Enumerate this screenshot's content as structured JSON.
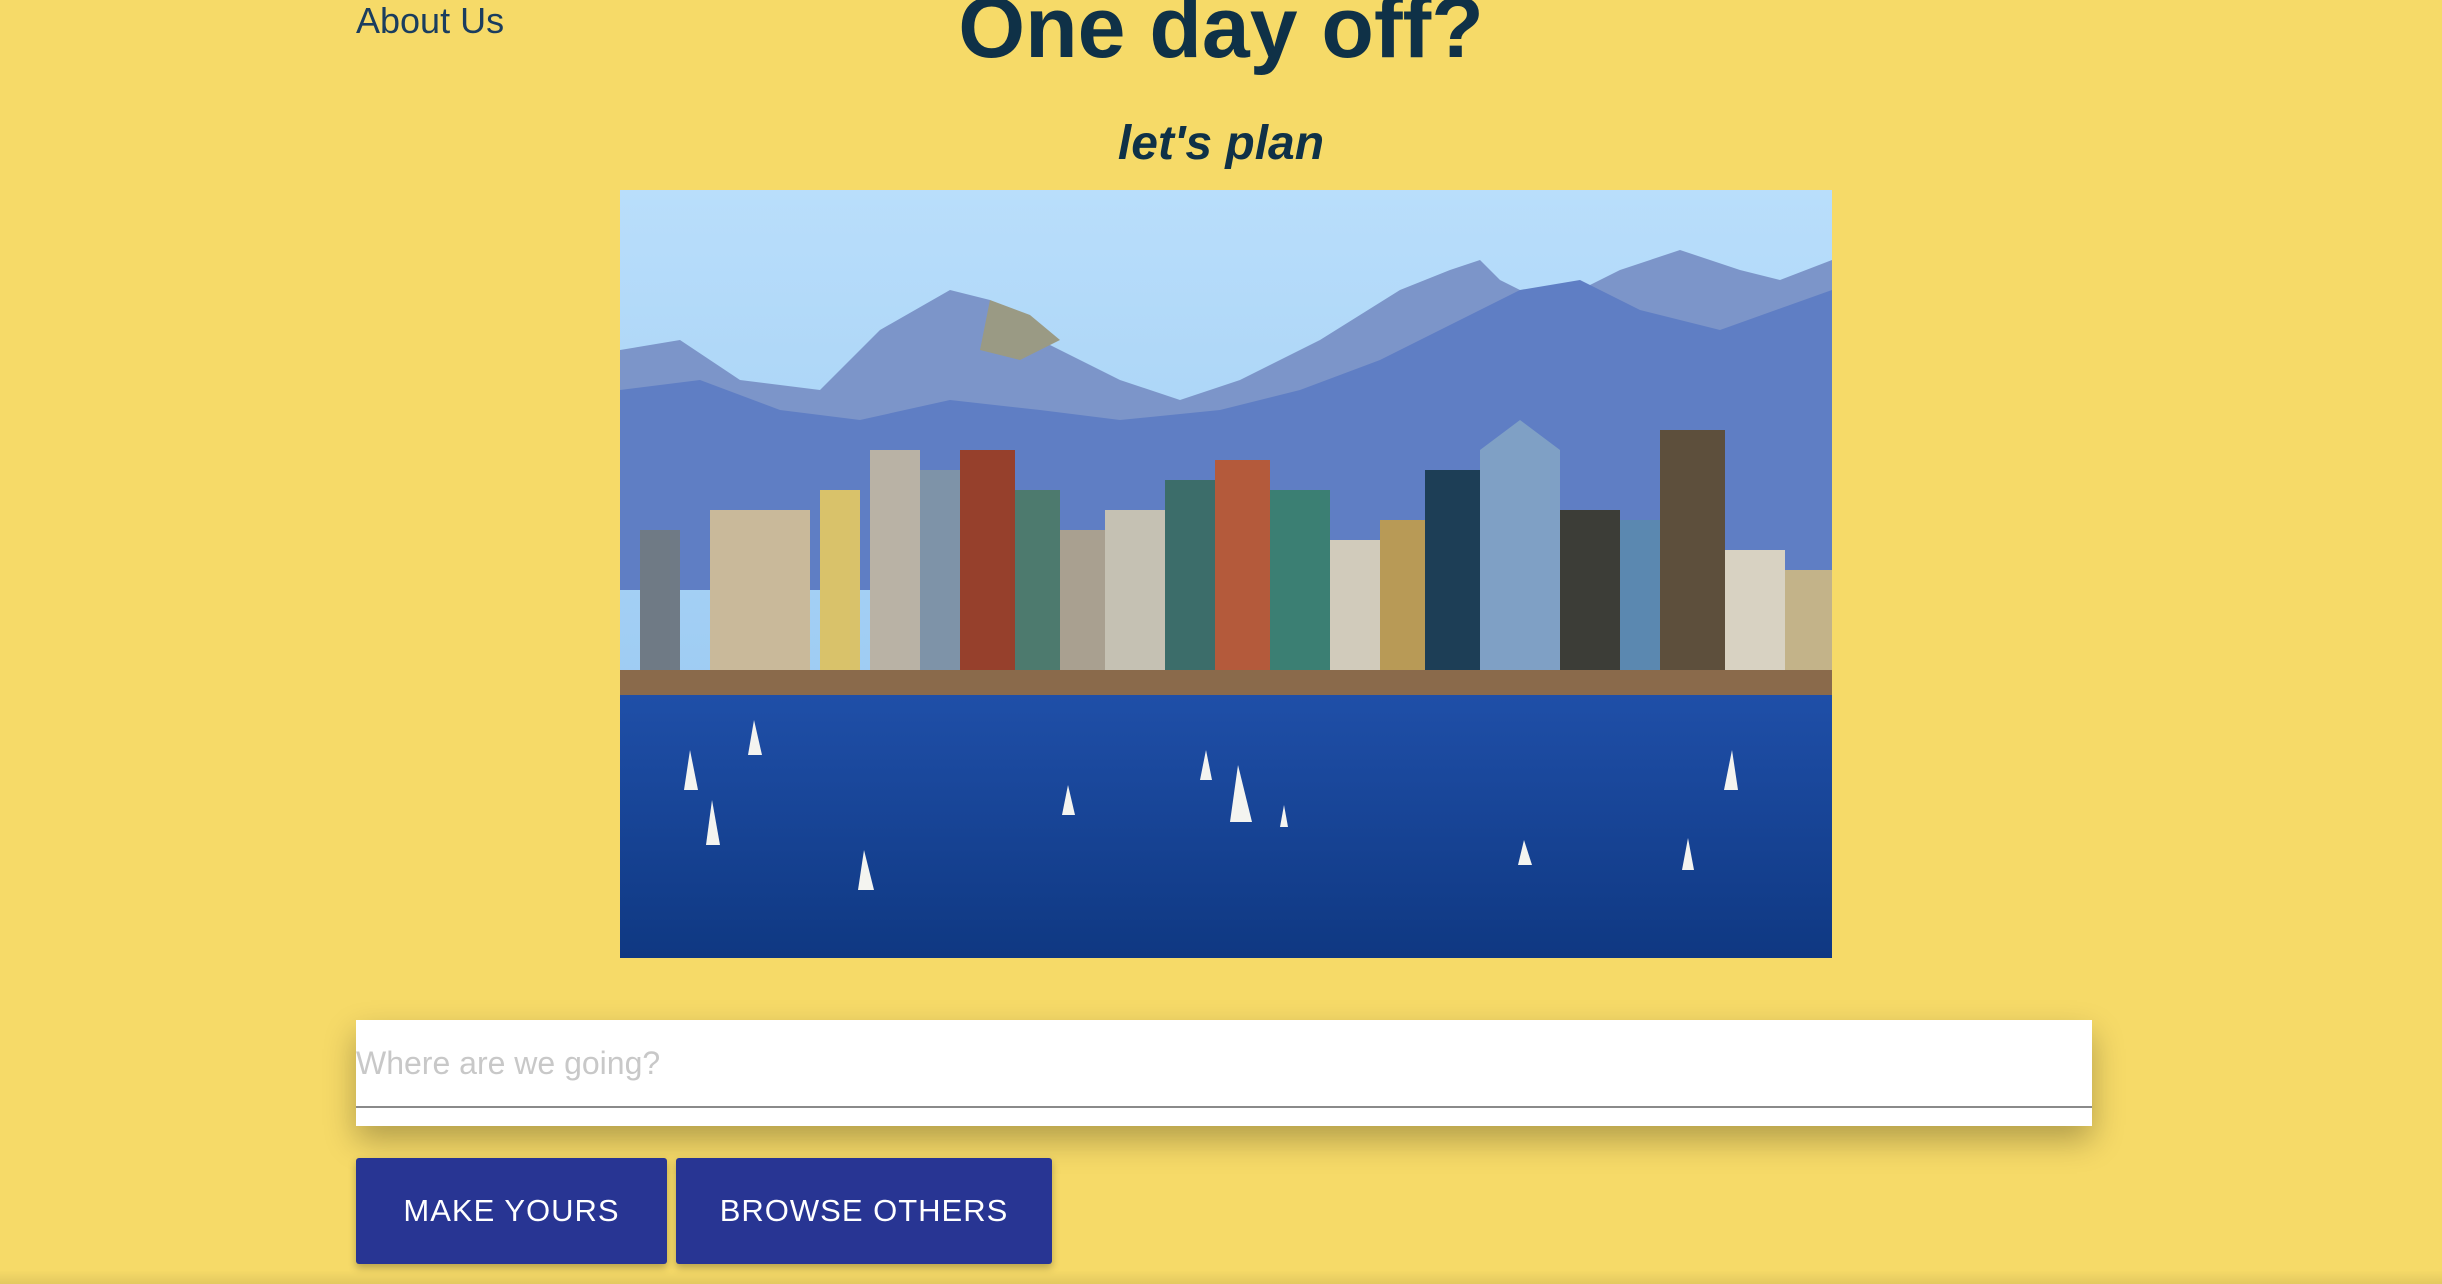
{
  "nav": {
    "about_label": "About Us"
  },
  "hero": {
    "title": "One day off?",
    "subtitle": "let's plan",
    "image_name": "city-skyline-bay-photo"
  },
  "search": {
    "placeholder": "Where are we going?",
    "value": ""
  },
  "actions": {
    "make_label": "MAKE YOURS",
    "browse_label": "BROWSE OTHERS"
  },
  "colors": {
    "background": "#f6da68",
    "title": "#0f3147",
    "link": "#1a3d5f",
    "button": "#283593",
    "button_text": "#ffffff"
  }
}
